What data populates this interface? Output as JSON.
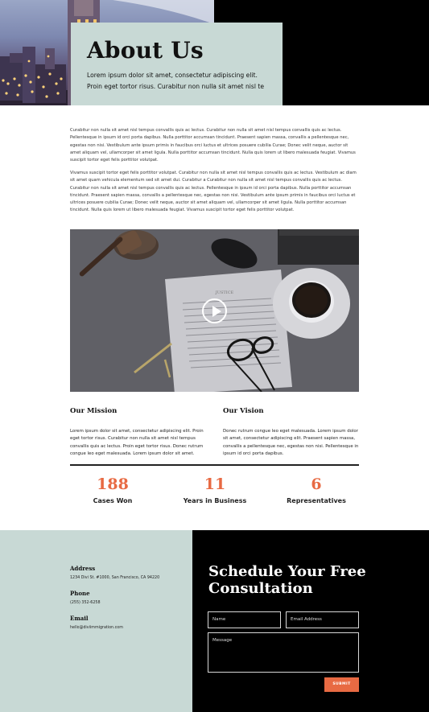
{
  "hero": {
    "title": "About Us",
    "subtitle": "Lorem ipsum dolor sit amet, consectetur adipiscing elit. Proin eget tortor risus. Curabitur non nulla sit amet nisl te"
  },
  "body": {
    "paragraphs": [
      "Curabitur non nulla sit amet nisl tempus convallis quis ac lectus. Curabitur non nulla sit amet nisl tempus convallis quis ac lectus. Pellentesque in ipsum id orci porta dapibus. Nulla porttitor accumsan tincidunt. Praesent sapien massa, convallis a pellentesque nec, egestas non nisi. Vestibulum ante ipsum primis in faucibus orci luctus et ultrices posuere cubilia Curae; Donec velit neque, auctor sit amet aliquam vel, ullamcorper sit amet ligula. Nulla porttitor accumsan tincidunt. Nulla quis lorem ut libero malesuada feugiat. Vivamus suscipit tortor eget felis porttitor volutpat.",
      "Vivamus suscipit tortor eget felis porttitor volutpat. Curabitur non nulla sit amet nisl tempus convallis quis ac lectus. Vestibulum ac diam sit amet quam vehicula elementum sed sit amet dui. Curabitur a Curabitur non nulla sit amet nisl tempus convallis quis ac lectus. Curabitur non nulla sit amet nisl tempus convallis quis ac lectus. Pellentesque in ipsum id orci porta dapibus. Nulla porttitor accumsan tincidunt. Praesent sapien massa, convallis a pellentesque nec, egestas non nisi. Vestibulum ante ipsum primis in faucibus orci luctus et ultrices posuere cubilia Curae; Donec velit neque, auctor sit amet aliquam vel, ullamcorper sit amet ligula. Nulla porttitor accumsan tincidunt. Nulla quis lorem ut libero malesuada feugiat. Vivamus suscipit tortor eget felis porttitor volutpat."
    ]
  },
  "video": {
    "play_icon": "play-icon",
    "document_heading": "JUSTICE"
  },
  "mission": {
    "title": "Our Mission",
    "text": "Lorem ipsum dolor sit amet, consectetur adipiscing elit. Proin eget tortor risus. Curabitur non nulla sit amet nisl tempus convallis quis ac lectus. Proin eget tortor risus. Donec rutrum congue leo eget malesuada. Lorem ipsum dolor sit amet."
  },
  "vision": {
    "title": "Our Vision",
    "text": "Donec rutrum congue leo eget malesuada. Lorem ipsum dolor sit amet, consectetur adipiscing elit. Praesent sapien massa, convallis a pellentesque nec, egestas non nisi. Pellentesque in ipsum id orci porta dapibus."
  },
  "stats": [
    {
      "value": "188",
      "label": "Cases Won"
    },
    {
      "value": "11",
      "label": "Years in Business"
    },
    {
      "value": "6",
      "label": "Representatives"
    }
  ],
  "contact": {
    "address_label": "Address",
    "address_value": "1234 Divi St. #1000, San Francisco, CA 94220",
    "phone_label": "Phone",
    "phone_value": "(255) 352-6258",
    "email_label": "Email",
    "email_value": "hello@diviimmigration.com"
  },
  "form": {
    "title": "Schedule Your Free Consultation",
    "name_placeholder": "Name",
    "email_placeholder": "Email Address",
    "message_placeholder": "Message",
    "submit_label": "SUBMIT"
  },
  "colors": {
    "accent": "#e86a43",
    "panel": "#c8d9d5",
    "dark": "#000000"
  }
}
